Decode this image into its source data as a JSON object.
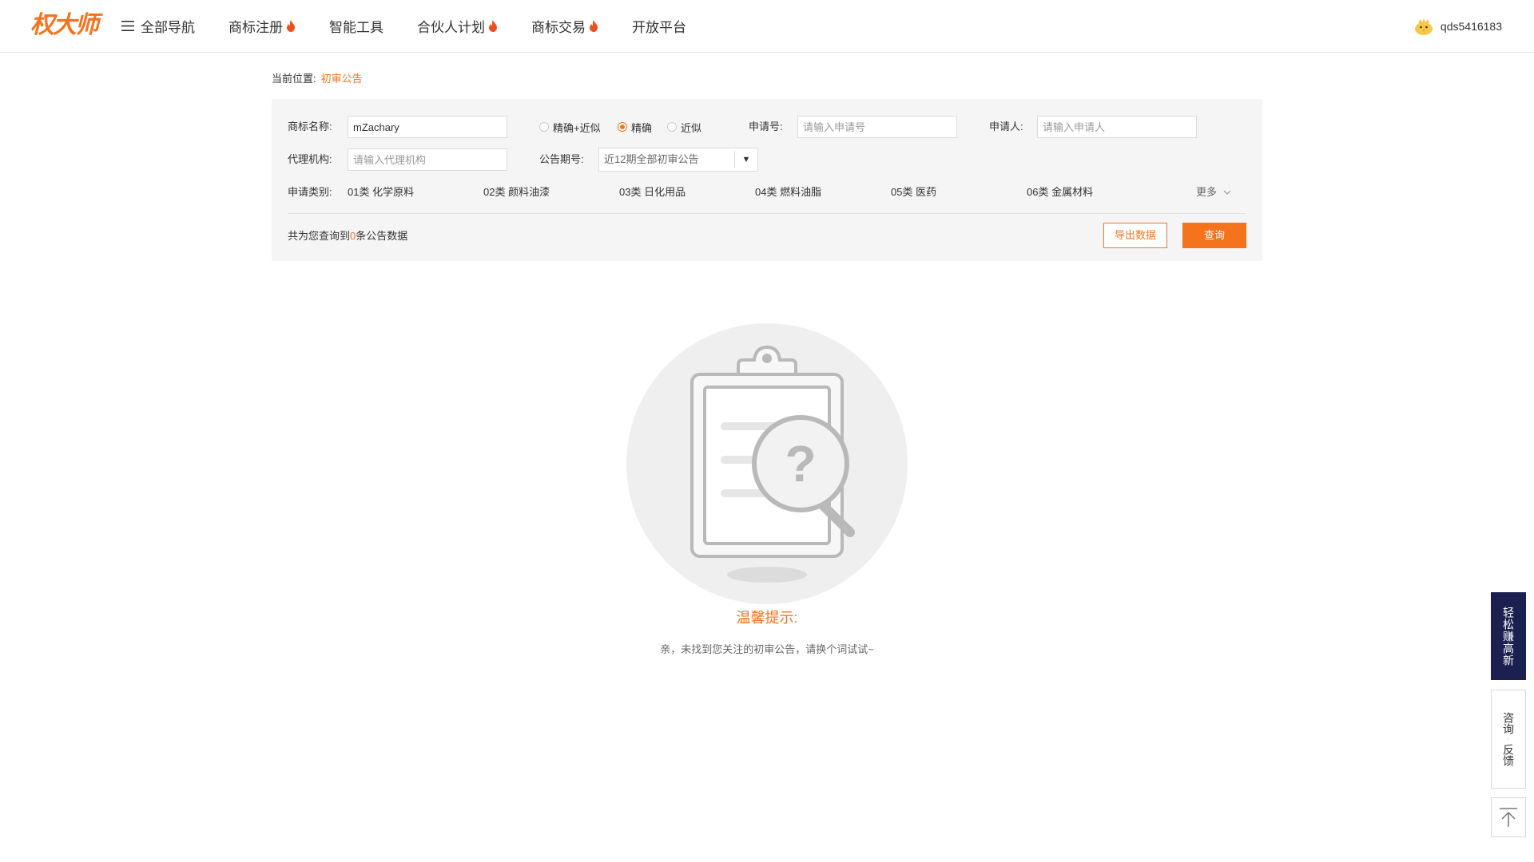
{
  "brand": {
    "logo_text": "权大师",
    "accent_color": "#f5731c"
  },
  "nav": {
    "items": [
      {
        "label": "全部导航",
        "icon": "menu-icon",
        "hot": false
      },
      {
        "label": "商标注册",
        "icon": "flame-icon",
        "hot": true
      },
      {
        "label": "智能工具",
        "icon": "",
        "hot": false
      },
      {
        "label": "合伙人计划",
        "icon": "flame-icon",
        "hot": true
      },
      {
        "label": "商标交易",
        "icon": "flame-icon",
        "hot": true
      },
      {
        "label": "开放平台",
        "icon": "",
        "hot": false
      }
    ],
    "user": {
      "name": "qds5416183",
      "avatar_icon": "chick-avatar-icon"
    }
  },
  "breadcrumb": {
    "prefix": "当前位置:",
    "current": "初审公告"
  },
  "search": {
    "trademark_label": "商标名称:",
    "trademark_value": "mZachary",
    "match_options": [
      {
        "label": "精确+近似",
        "selected": false
      },
      {
        "label": "精确",
        "selected": true
      },
      {
        "label": "近似",
        "selected": false
      }
    ],
    "app_no_label": "申请号:",
    "app_no_placeholder": "请输入申请号",
    "applicant_label": "申请人:",
    "applicant_placeholder": "请输入申请人",
    "agency_label": "代理机构:",
    "agency_placeholder": "请输入代理机构",
    "issue_label": "公告期号:",
    "issue_value": "近12期全部初审公告",
    "category_label": "申请类别:",
    "categories": [
      "01类 化学原料",
      "02类 颜料油漆",
      "03类 日化用品",
      "04类 燃料油脂",
      "05类 医药",
      "06类 金属材料"
    ],
    "more_label": "更多",
    "result_prefix": "共为您查询到",
    "result_count": "0",
    "result_suffix": "条公告数据",
    "export_label": "导出数据",
    "query_label": "查询"
  },
  "empty_state": {
    "icon": "clipboard-question-icon",
    "title": "温馨提示:",
    "message": "亲，未找到您关注的初审公告，请换个词试试~"
  },
  "sidebar_float": {
    "promo_label": "轻松赚高新",
    "feedback_top": "咨询",
    "feedback_sep": "-",
    "feedback_bottom": "反馈",
    "back_top_icon": "back-to-top-icon",
    "promo_bg": "#1c2050"
  }
}
